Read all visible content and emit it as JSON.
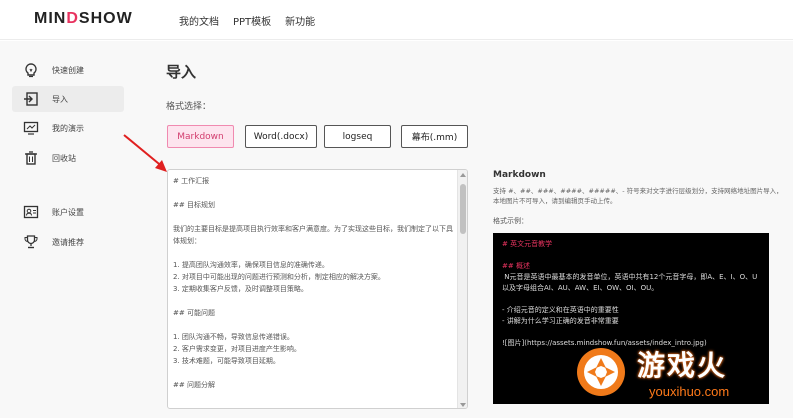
{
  "header": {
    "logo_part1": "MIN",
    "logo_accent": "D",
    "logo_part2": "SHOW",
    "nav": [
      "我的文档",
      "PPT模板",
      "新功能"
    ]
  },
  "sidebar": {
    "items": [
      {
        "label": "快速创建",
        "icon": "lightbulb-icon"
      },
      {
        "label": "导入",
        "icon": "import-icon",
        "active": true
      },
      {
        "label": "我的演示",
        "icon": "presentation-icon"
      },
      {
        "label": "回收站",
        "icon": "trash-icon"
      },
      {
        "label": "账户设置",
        "icon": "account-icon"
      },
      {
        "label": "邀请推荐",
        "icon": "trophy-icon"
      }
    ]
  },
  "main": {
    "title": "导入",
    "format_label": "格式选择：",
    "formats": [
      "Markdown",
      "Word(.docx)",
      "logseq",
      "幕布(.mm)"
    ],
    "editor_text": "# 工作汇报\n\n## 目标规划\n\n我们的主要目标是提高项目执行效率和客户满意度。为了实现这些目标，我们制定了以下具体规划：\n\n1. 提高团队沟通效率，确保项目信息的准确传递。\n2. 对项目中可能出现的问题进行预测和分析，制定相应的解决方案。\n3. 定期收集客户反馈，及时调整项目策略。\n\n## 可能问题\n\n1. 团队沟通不畅，导致信息传递错误。\n2. 客户需求变更，对项目进度产生影响。\n3. 技术难题，可能导致项目延期。\n\n## 问题分解"
  },
  "preview": {
    "title": "Markdown",
    "desc": "支持 #、##、###、####、#####、- 符号来对文字进行层级划分，支持网络地址图片导入，本地图片不可导入，请到编辑页手动上传。",
    "example_label": "格式示例：",
    "example_lines": [
      "# 英文元音教学",
      "",
      "## 概述",
      " N元音是英语中最基本的发音单位，英语中共有12个元音字母，即A、E、I、O、U以及字母组合AI、AU、AW、EI、OW、OI、OU。",
      "",
      "- 介绍元音的定义和在英语中的重要性",
      "- 讲解为什么学习正确的发音非常重要",
      "",
      "![图片](https://assets.mindshow.fun/assets/index_intro.jpg)"
    ]
  },
  "watermark": {
    "text": "游戏火",
    "url": "youxihuo.com"
  },
  "colors": {
    "accent": "#e8335f",
    "active_format_bg": "#fde4ee",
    "annotation_arrow": "#e02020"
  }
}
